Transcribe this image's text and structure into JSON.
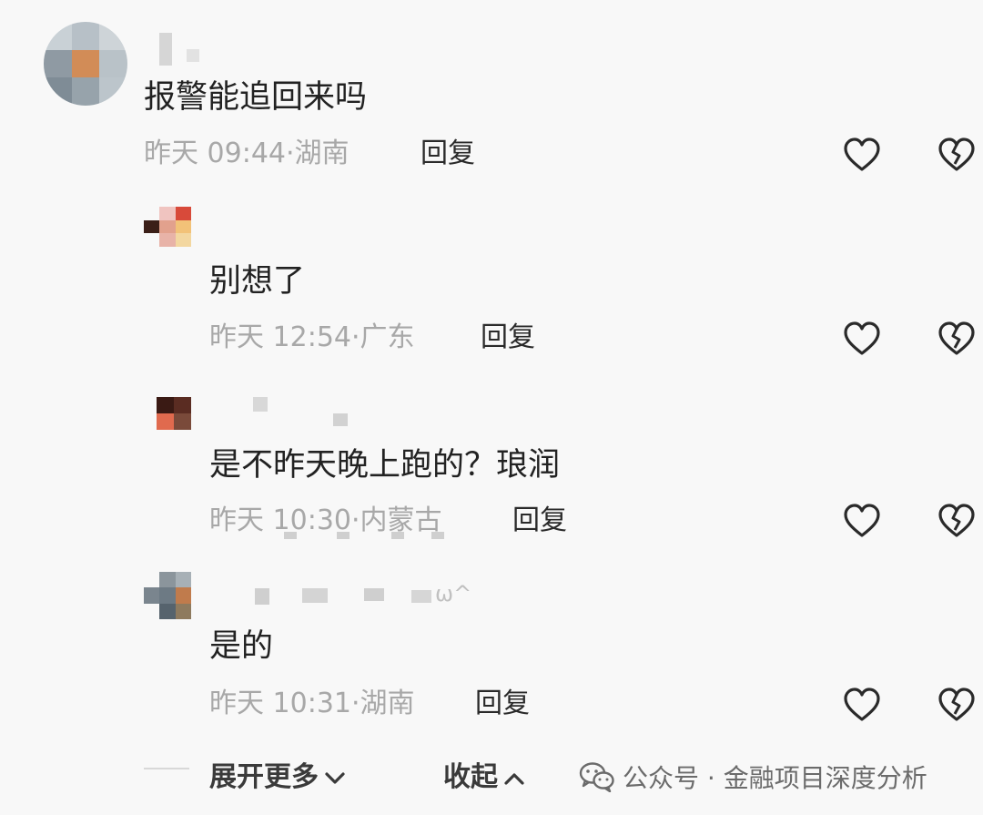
{
  "comments": [
    {
      "text": "报警能追回来吗",
      "time": "昨天 09:44",
      "location": "湖南",
      "reply_label": "回复"
    },
    {
      "text": "别想了",
      "time": "昨天 12:54",
      "location": "广东",
      "reply_label": "回复"
    },
    {
      "text": "是不昨天晚上跑的？琅润",
      "time": "昨天 10:30",
      "location": "内蒙古",
      "reply_label": "回复"
    },
    {
      "text": "是的",
      "time": "昨天 10:31",
      "location": "湖南",
      "reply_label": "回复"
    }
  ],
  "footer": {
    "expand_label": "展开更多",
    "collapse_label": "收起"
  },
  "watermark": {
    "text": "公众号 · 金融项目深度分析"
  },
  "icons": {
    "like": "heart-outline-icon",
    "dislike": "broken-heart-icon",
    "expand": "chevron-down-icon",
    "collapse": "chevron-up-icon",
    "watermark": "wechat-icon"
  }
}
